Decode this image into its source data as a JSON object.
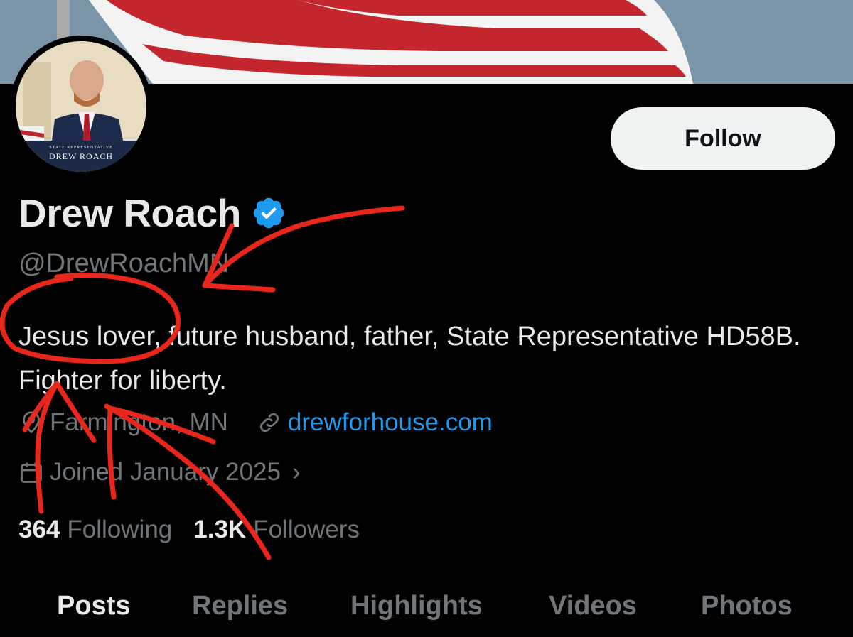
{
  "profile": {
    "display_name": "Drew Roach",
    "handle": "@DrewRoachMN",
    "bio": "Jesus lover, future husband, father, State Representative HD58B. Fighter for liberty.",
    "location": "Farmington, MN",
    "website": "drewforhouse.com",
    "joined": "Joined January 2025",
    "joined_chevron": "›",
    "avatar_caption_small": "STATE REPRESENTATIVE",
    "avatar_caption_big": "DREW ROACH"
  },
  "stats": {
    "following_count": "364",
    "following_label": "Following",
    "followers_count": "1.3K",
    "followers_label": "Followers"
  },
  "actions": {
    "follow_label": "Follow"
  },
  "tabs": [
    {
      "label": "Posts",
      "active": true
    },
    {
      "label": "Replies",
      "active": false
    },
    {
      "label": "Highlights",
      "active": false
    },
    {
      "label": "Videos",
      "active": false
    },
    {
      "label": "Photos",
      "active": false
    }
  ],
  "icons": {
    "verified": "verified-badge-icon",
    "location": "location-pin-icon",
    "link": "link-icon",
    "calendar": "calendar-icon"
  },
  "colors": {
    "background": "#000000",
    "primary_text": "#e7e9ea",
    "secondary_text": "#71767b",
    "link": "#1d9bf0",
    "verified": "#1d9bf0",
    "annotation": "#e8261c"
  }
}
